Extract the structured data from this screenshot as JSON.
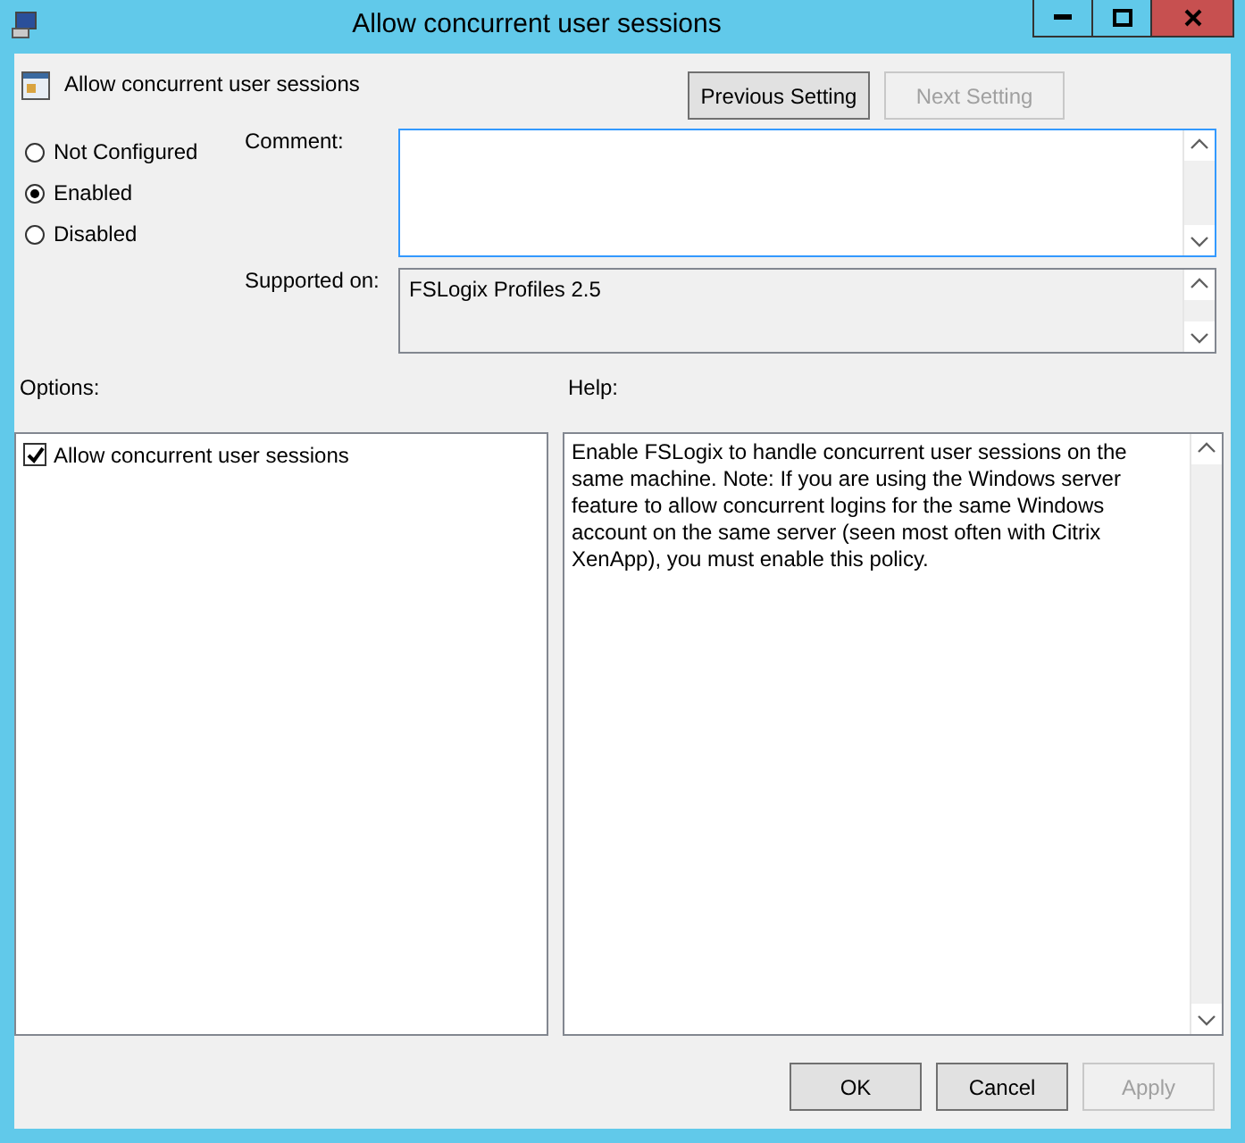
{
  "window": {
    "title": "Allow concurrent user sessions"
  },
  "setting": {
    "title": "Allow concurrent user sessions"
  },
  "nav_buttons": [
    {
      "label": "Previous Setting",
      "disabled": false
    },
    {
      "label": "Next Setting",
      "disabled": true
    }
  ],
  "state_options": [
    {
      "label": "Not Configured",
      "selected": false
    },
    {
      "label": "Enabled",
      "selected": true
    },
    {
      "label": "Disabled",
      "selected": false
    }
  ],
  "comment": {
    "label": "Comment:"
  },
  "supported_on": {
    "label": "Supported on:",
    "value": "FSLogix Profiles 2.5"
  },
  "options": {
    "label": "Options:",
    "items": [
      {
        "label": "Allow concurrent user sessions",
        "checked": true
      }
    ]
  },
  "help": {
    "label": "Help:",
    "text": "Enable FSLogix to handle concurrent user sessions on the same machine. Note: If you are using the Windows server feature to allow concurrent logins for the same Windows account on the same server (seen most often with Citrix XenApp), you must enable this policy."
  },
  "buttons": [
    {
      "label": "OK",
      "disabled": false
    },
    {
      "label": "Cancel",
      "disabled": false
    },
    {
      "label": "Apply",
      "disabled": true
    }
  ]
}
